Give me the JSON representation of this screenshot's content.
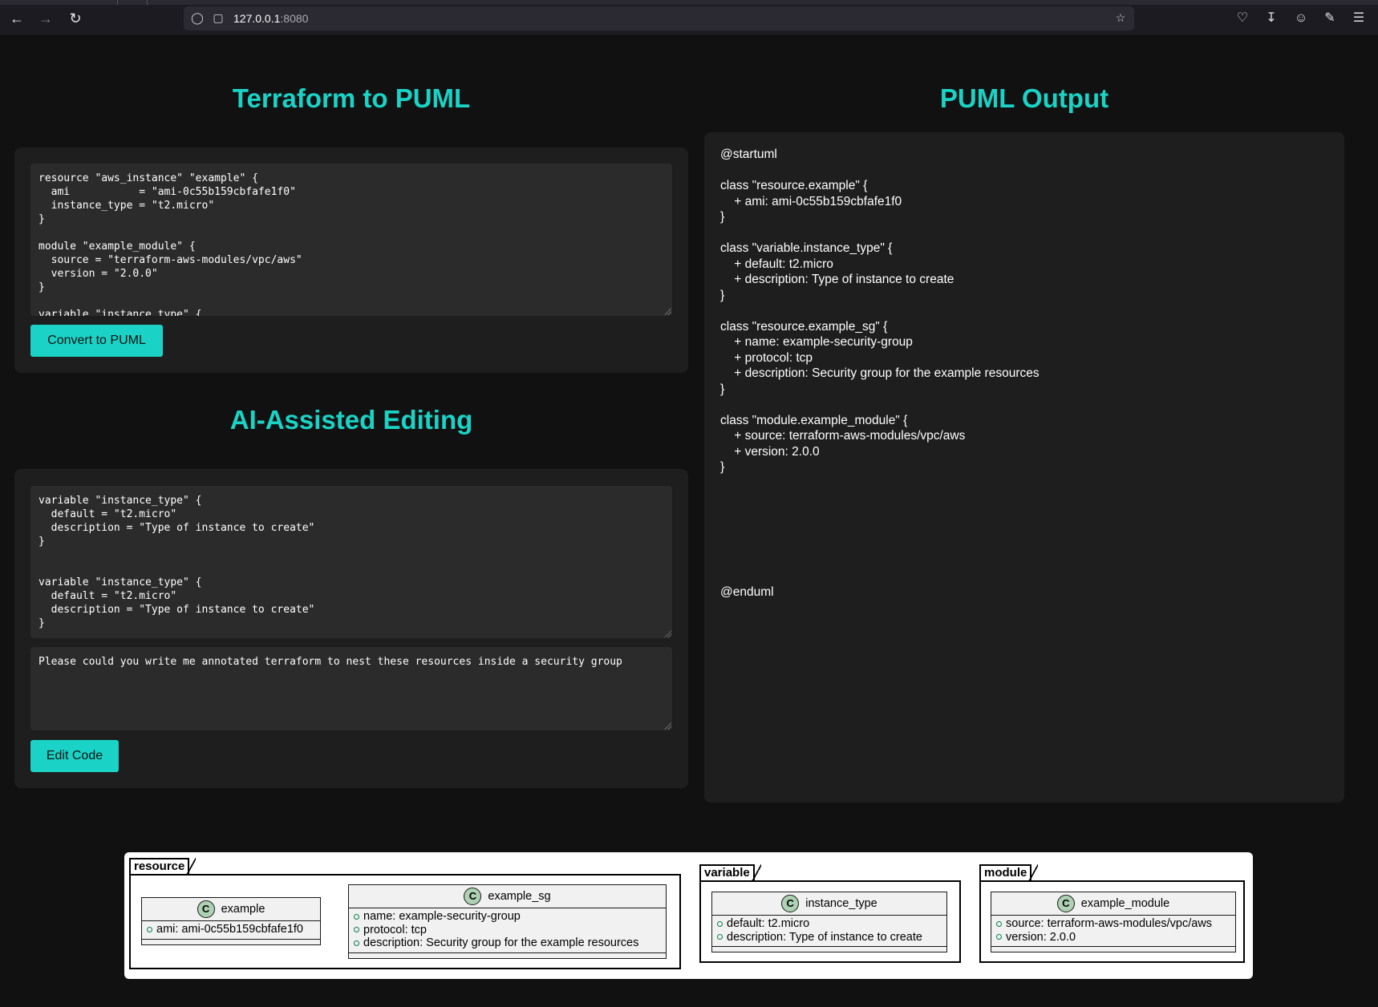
{
  "browser": {
    "url_host": "127.0.0.1",
    "url_port": ":8080"
  },
  "left": {
    "title": "Terraform to PUML",
    "terraform_code": "resource \"aws_instance\" \"example\" {\n  ami           = \"ami-0c55b159cbfafe1f0\"\n  instance_type = \"t2.micro\"\n}\n\nmodule \"example_module\" {\n  source = \"terraform-aws-modules/vpc/aws\"\n  version = \"2.0.0\"\n}\n\nvariable \"instance_type\" {",
    "convert_label": "Convert to PUML",
    "ai_title": "AI-Assisted Editing",
    "ai_code": "variable \"instance_type\" {\n  default = \"t2.micro\"\n  description = \"Type of instance to create\"\n}\n\n\nvariable \"instance_type\" {\n  default = \"t2.micro\"\n  description = \"Type of instance to create\"\n}",
    "prompt": "Please could you write me annotated terraform to nest these resources inside a security group",
    "edit_label": "Edit Code"
  },
  "right": {
    "title": "PUML Output",
    "output": "@startuml\n\nclass \"resource.example\" {\n    + ami: ami-0c55b159cbfafe1f0\n}\n\nclass \"variable.instance_type\" {\n    + default: t2.micro\n    + description: Type of instance to create\n}\n\nclass \"resource.example_sg\" {\n    + name: example-security-group\n    + protocol: tcp\n    + description: Security group for the example resources\n}\n\nclass \"module.example_module\" {\n    + source: terraform-aws-modules/vpc/aws\n    + version: 2.0.0\n}\n\n\n\n\n\n\n\n@enduml"
  },
  "diagram": {
    "packages": {
      "resource": "resource",
      "variable": "variable",
      "module": "module"
    },
    "classes": {
      "example": {
        "name": "example",
        "attrs": [
          "ami: ami-0c55b159cbfafe1f0"
        ]
      },
      "example_sg": {
        "name": "example_sg",
        "attrs": [
          "name: example-security-group",
          "protocol: tcp",
          "description: Security group for the example resources"
        ]
      },
      "instance_type": {
        "name": "instance_type",
        "attrs": [
          "default: t2.micro",
          "description: Type of instance to create"
        ]
      },
      "example_module": {
        "name": "example_module",
        "attrs": [
          "source: terraform-aws-modules/vpc/aws",
          "version: 2.0.0"
        ]
      }
    },
    "class_icon_letter": "C"
  }
}
